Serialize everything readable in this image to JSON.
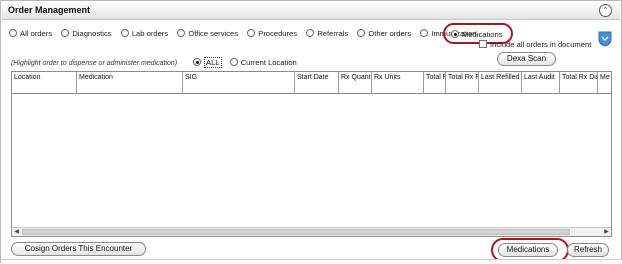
{
  "header": {
    "title": "Order Management",
    "collapse_glyph": "⌃"
  },
  "filters": {
    "radios": [
      {
        "label": "All orders",
        "selected": false
      },
      {
        "label": "Diagnostics",
        "selected": false
      },
      {
        "label": "Lab orders",
        "selected": false
      },
      {
        "label": "Office services",
        "selected": false
      },
      {
        "label": "Procedures",
        "selected": false
      },
      {
        "label": "Referrals",
        "selected": false
      },
      {
        "label": "Other orders",
        "selected": false
      },
      {
        "label": "Immunization",
        "selected": false
      }
    ],
    "medications": {
      "label": "Medications",
      "selected": true
    },
    "include_all_label": "Include all orders in document"
  },
  "dexa_scan_label": "Dexa Scan",
  "highlight_note": "(Highlight order to dispense or administer medication)",
  "location_filter": {
    "all_label": "ALL",
    "current_label": "Current Location",
    "selected": "ALL"
  },
  "table": {
    "columns": [
      "Location",
      "Medication",
      "SIG",
      "Start Date",
      "Rx Quantity",
      "Rx Units",
      "Total Rx",
      "Total Rx Remain",
      "Last Refilled",
      "Last Audit",
      "Total Rx Dispensed",
      "Me"
    ],
    "rows": []
  },
  "buttons": {
    "cosign": "Cosign Orders This Encounter",
    "medications": "Medications",
    "refresh": "Refresh"
  },
  "icons": {
    "shield": "shield-icon",
    "collapse": "collapse-up-icon",
    "scroll_left": "scroll-left-arrow-icon",
    "scroll_right": "scroll-right-arrow-icon"
  },
  "colors": {
    "highlight_ring": "#b5121b",
    "shield": "#4a90d9"
  }
}
